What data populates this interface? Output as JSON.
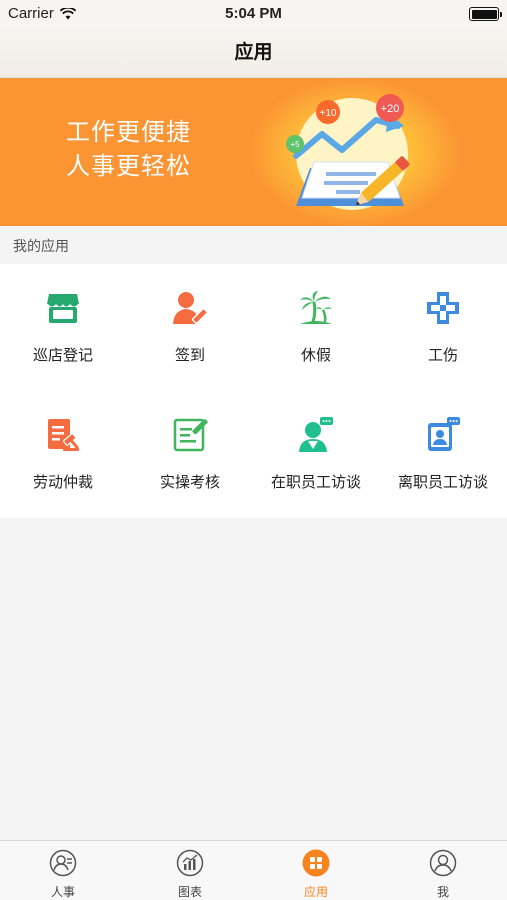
{
  "status_bar": {
    "carrier": "Carrier",
    "time": "5:04 PM",
    "battery_level": 1.0
  },
  "nav": {
    "title": "应用"
  },
  "banner": {
    "line1": "工作更便捷",
    "line2": "人事更轻松",
    "badges": [
      "+5",
      "+10",
      "+20"
    ]
  },
  "section": {
    "title": "我的应用"
  },
  "apps": [
    {
      "label": "巡店登记",
      "icon": "store-icon",
      "color": "#27a86e"
    },
    {
      "label": "签到",
      "icon": "sign-in-person-icon",
      "color": "#f46c3f"
    },
    {
      "label": "休假",
      "icon": "palm-tree-icon",
      "color": "#3fb65c"
    },
    {
      "label": "工伤",
      "icon": "medical-cross-icon",
      "color": "#3d8be0"
    },
    {
      "label": "劳动仲裁",
      "icon": "arbitration-document-icon",
      "color": "#f46c3f"
    },
    {
      "label": "实操考核",
      "icon": "edit-document-icon",
      "color": "#3fb65c"
    },
    {
      "label": "在职员工访谈",
      "icon": "employee-chat-icon",
      "color": "#1fbf8f"
    },
    {
      "label": "离职员工访谈",
      "icon": "badge-chat-icon",
      "color": "#3d8be0"
    }
  ],
  "tabs": [
    {
      "label": "人事",
      "icon": "person-icon",
      "active": false
    },
    {
      "label": "图表",
      "icon": "chart-icon",
      "active": false
    },
    {
      "label": "应用",
      "icon": "apps-grid-icon",
      "active": true
    },
    {
      "label": "我",
      "icon": "user-profile-icon",
      "active": false
    }
  ],
  "colors": {
    "accent": "#f7831f",
    "banner": "#fb9433",
    "tab_inactive": "#444444"
  }
}
